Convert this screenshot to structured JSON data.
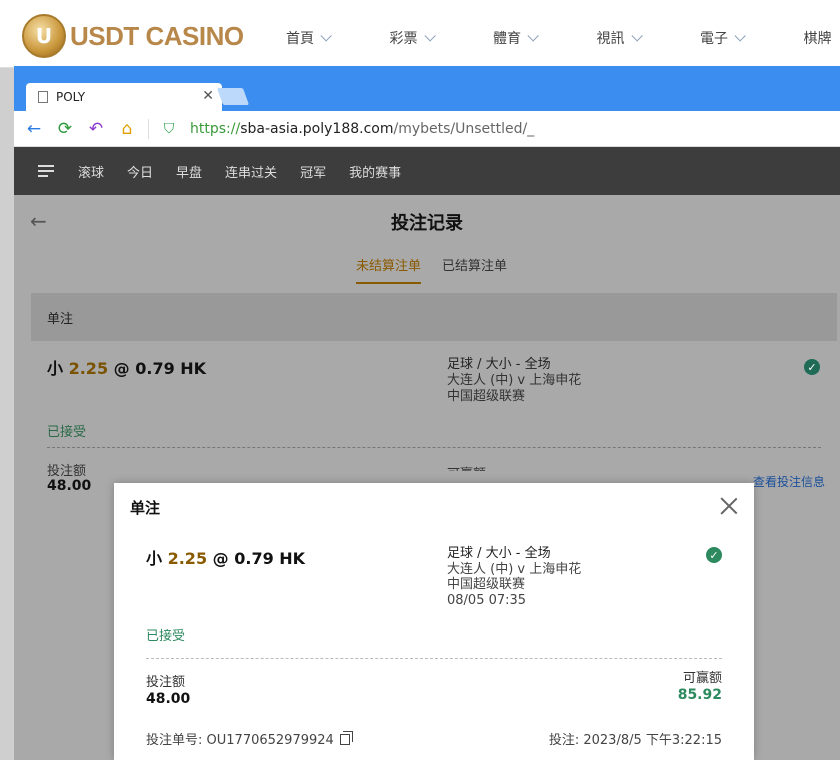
{
  "site": {
    "logo_text": "USDT CASINO",
    "nav": [
      "首頁",
      "彩票",
      "體育",
      "視訊",
      "電子",
      "棋牌"
    ]
  },
  "browser": {
    "tab_title": "POLY",
    "url_proto": "https://",
    "url_host": "sba-asia.poly188.com",
    "url_path": "/mybets/Unsettled/_"
  },
  "page": {
    "nav": [
      "滚球",
      "今日",
      "早盘",
      "连串过关",
      "冠军",
      "我的赛事"
    ],
    "title": "投注记录",
    "tabs": {
      "unsettled": "未结算注单",
      "settled": "已结算注单"
    },
    "section": "单注",
    "bet": {
      "selection": "小",
      "line": "2.25",
      "at": "@",
      "price": "0.79 HK",
      "market": "足球 / 大小 - 全场",
      "match": "大连人 (中) v 上海申花",
      "league": "中国超级联赛",
      "status": "已接受",
      "stake_label": "投注额",
      "stake": "48.00",
      "payout_label": "可赢额",
      "view_info": "查看投注信息"
    }
  },
  "modal": {
    "title": "单注",
    "selection": "小",
    "line": "2.25",
    "at": "@",
    "price": "0.79 HK",
    "market": "足球 / 大小 - 全场",
    "match": "大连人 (中) v 上海申花",
    "league": "中国超级联赛",
    "kickoff": "08/05 07:35",
    "status": "已接受",
    "stake_label": "投注额",
    "stake": "48.00",
    "payout_label": "可赢额",
    "payout": "85.92",
    "ticket_label": "投注单号:",
    "ticket_no": "OU1770652979924",
    "placed_label": "投注:",
    "placed_time": "2023/8/5 下午3:22:15"
  }
}
